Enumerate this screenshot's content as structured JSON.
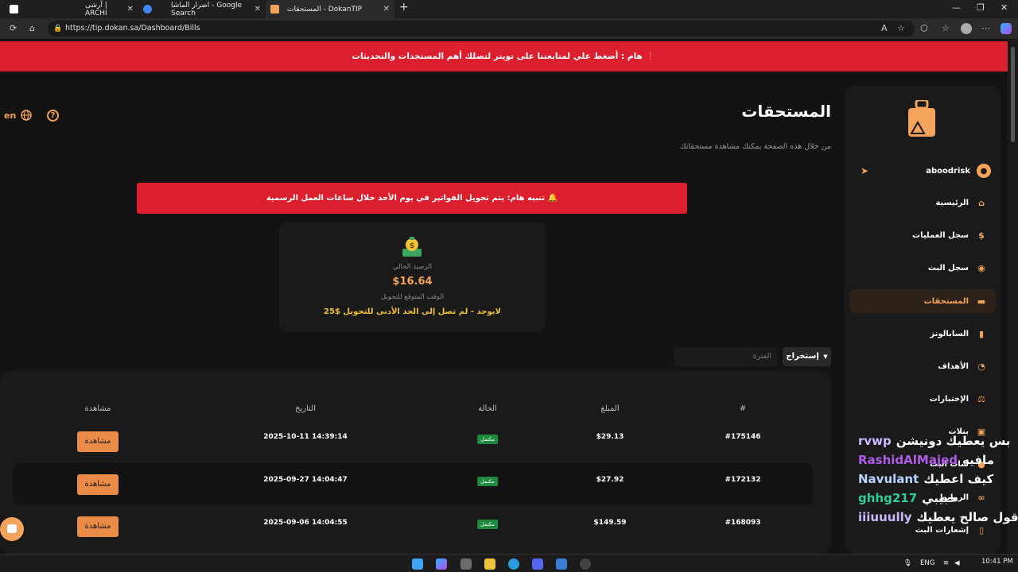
{
  "browser": {
    "tabs": [
      {
        "title": "آرشی | ARCHI"
      },
      {
        "title": "اضرار الماشا - Google Search"
      },
      {
        "title": "المستحقات - DokanTIP"
      }
    ],
    "url": "https://tip.dokan.sa/Dashboard/Bills"
  },
  "banner": {
    "text": "❗ هام : أضغط علي لمتابعتنا على تويتر لتصلك أهم المستجدات والتحديثات"
  },
  "header": {
    "lang": "en"
  },
  "sidebar": {
    "username": "aboodrisk",
    "items": [
      {
        "label": "الرئيسية",
        "icon": "home-icon",
        "glyph": "⌂"
      },
      {
        "label": "سجل العمليات",
        "icon": "dollar-icon",
        "glyph": "$"
      },
      {
        "label": "سجل البث",
        "icon": "broadcast-icon",
        "glyph": "◉"
      },
      {
        "label": "المستحقات",
        "icon": "wallet-icon",
        "glyph": "▬"
      },
      {
        "label": "السابالونز",
        "icon": "file-icon",
        "glyph": "▮"
      },
      {
        "label": "الأهداف",
        "icon": "pie-chart-icon",
        "glyph": "◔"
      },
      {
        "label": "الإختبارات",
        "icon": "tests-icon",
        "glyph": "⚖"
      },
      {
        "label": "بنلات",
        "icon": "panel-icon",
        "glyph": "▣"
      },
      {
        "label": "شات البث",
        "icon": "chat-icon",
        "glyph": "●"
      },
      {
        "label": "الروابط",
        "icon": "link-icon",
        "glyph": "∞"
      },
      {
        "label": "إشعارات البث",
        "icon": "phone-icon",
        "glyph": "▯"
      }
    ]
  },
  "chat_overlay": [
    {
      "name": "rvwp",
      "msg": "بس يعطيك دونيشن",
      "color": "#c9b8ff"
    },
    {
      "name": "RashidAlMajed",
      "msg": "مافيه",
      "color": "#b05ce6"
    },
    {
      "name": "Navulant",
      "msg": "كيف اعطيك",
      "color": "#b9d4ff"
    },
    {
      "name": "ghhg217",
      "msg": "حبيبي",
      "color": "#2ecc9a"
    },
    {
      "name": "iiiuuully",
      "msg": "قول صالح يعطيك",
      "color": "#c9b8ff"
    }
  ],
  "main": {
    "title": "المستحقات",
    "subtitle": "من خلال هذه الصفحة يمكنك مشاهدة مستحقاتك",
    "alert": "🔔 تنبيه هام: يتم تحويل الفواتير في يوم الأحد خلال ساعات العمل الرسمية",
    "balance": {
      "label": "الرصيد الحالي",
      "value": "$16.64",
      "eta_label": "الوقت المتوقع للتحويل",
      "eta_value": "لايوجد - لم تصل إلى الحد الأدنى للتحويل $25"
    },
    "export_label": "إستخراج",
    "period_placeholder": "الفترة"
  },
  "table": {
    "headers": [
      "#",
      "المبلغ",
      "الحالة",
      "التاريخ",
      "مشاهدة"
    ],
    "rows": [
      {
        "id": "#175146",
        "amount": "$29.13",
        "status": "مكتمل",
        "date": "2025-10-11 14:39:14",
        "action": "مشاهدة"
      },
      {
        "id": "#172132",
        "amount": "$27.92",
        "status": "مكتمل",
        "date": "2025-09-27 14:04:47",
        "action": "مشاهدة"
      },
      {
        "id": "#168093",
        "amount": "$149.59",
        "status": "مكتمل",
        "date": "2025-09-06 14:04:55",
        "action": "مشاهدة"
      }
    ]
  },
  "taskbar": {
    "lang": "ENG",
    "time": "10:41 PM"
  },
  "colors": {
    "accent": "#f3a35c",
    "danger": "#dc1f2e",
    "success": "#1e8a3d",
    "background": "#131313"
  }
}
